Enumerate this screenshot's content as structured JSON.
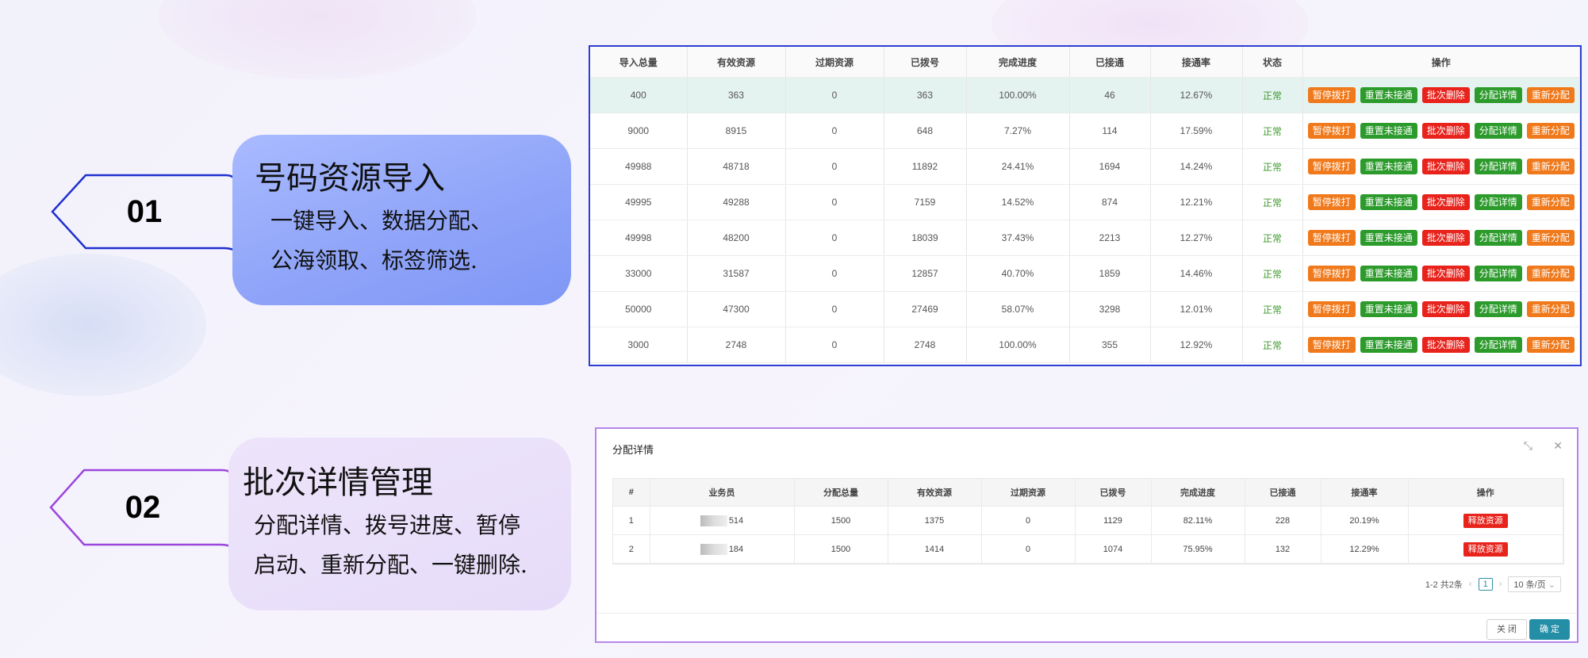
{
  "features": [
    {
      "num": "01",
      "title": "号码资源导入",
      "desc": "一键导入、数据分配、\n公海领取、标签筛选.",
      "color": "#1f2fd0"
    },
    {
      "num": "02",
      "title": "批次详情管理",
      "desc": "分配详情、拨号进度、暂停\n启动、重新分配、一键删除.",
      "color": "#9b45de"
    }
  ],
  "batch_table": {
    "headers": [
      "导入总量",
      "有效资源",
      "过期资源",
      "已拨号",
      "完成进度",
      "已接通",
      "接通率",
      "状态",
      "操作"
    ],
    "rows": [
      [
        "400",
        "363",
        "0",
        "363",
        "100.00%",
        "46",
        "12.67%",
        "正常"
      ],
      [
        "9000",
        "8915",
        "0",
        "648",
        "7.27%",
        "114",
        "17.59%",
        "正常"
      ],
      [
        "49988",
        "48718",
        "0",
        "11892",
        "24.41%",
        "1694",
        "14.24%",
        "正常"
      ],
      [
        "49995",
        "49288",
        "0",
        "7159",
        "14.52%",
        "874",
        "12.21%",
        "正常"
      ],
      [
        "49998",
        "48200",
        "0",
        "18039",
        "37.43%",
        "2213",
        "12.27%",
        "正常"
      ],
      [
        "33000",
        "31587",
        "0",
        "12857",
        "40.70%",
        "1859",
        "14.46%",
        "正常"
      ],
      [
        "50000",
        "47300",
        "0",
        "27469",
        "58.07%",
        "3298",
        "12.01%",
        "正常"
      ],
      [
        "3000",
        "2748",
        "0",
        "2748",
        "100.00%",
        "355",
        "12.92%",
        "正常"
      ]
    ],
    "actions": [
      "暂停拨打",
      "重置未接通",
      "批次删除",
      "分配详情",
      "重新分配"
    ]
  },
  "detail_modal": {
    "title": "分配详情",
    "headers": [
      "#",
      "业务员",
      "分配总量",
      "有效资源",
      "过期资源",
      "已拨号",
      "完成进度",
      "已接通",
      "接通率",
      "操作"
    ],
    "rows": [
      [
        "1",
        "514",
        "1500",
        "1375",
        "0",
        "1129",
        "82.11%",
        "228",
        "20.19%"
      ],
      [
        "2",
        "184",
        "1500",
        "1414",
        "0",
        "1074",
        "75.95%",
        "132",
        "12.29%"
      ]
    ],
    "row_action": "释放资源",
    "pager": {
      "total": "1-2 共2条",
      "current": "1",
      "page_size": "10 条/页"
    },
    "close_label": "关 闭",
    "ok_label": "确 定"
  }
}
